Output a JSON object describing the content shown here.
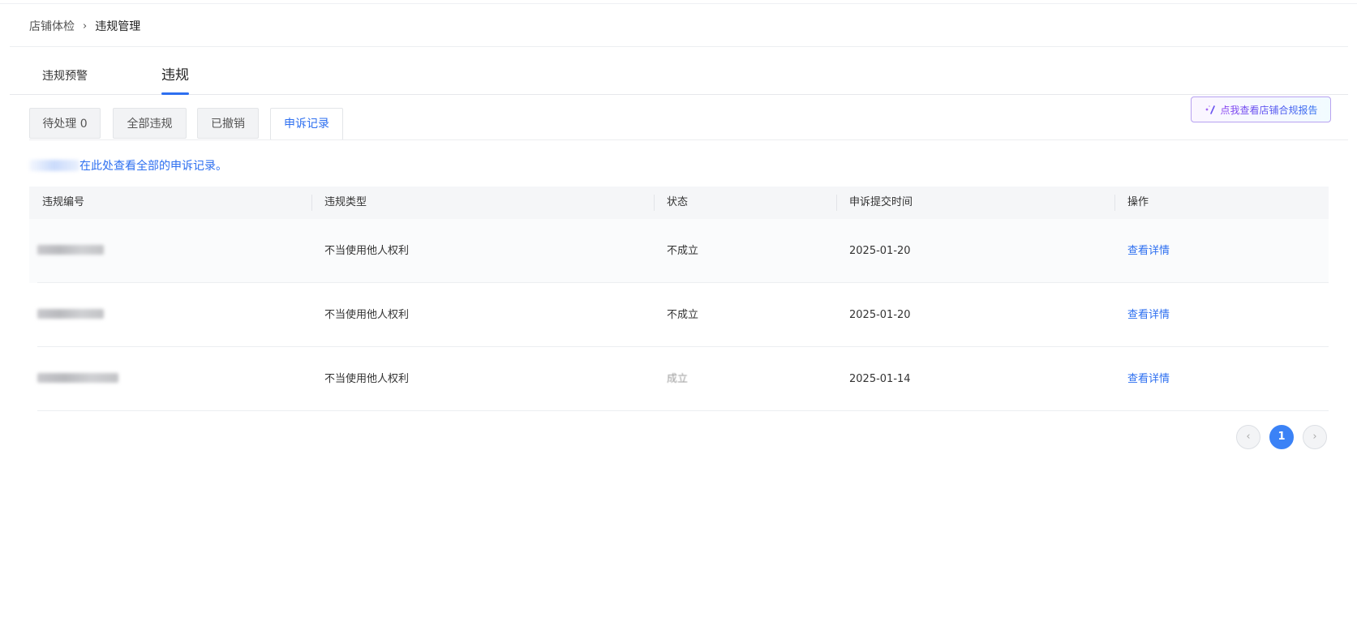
{
  "breadcrumb": {
    "parent": "店铺体检",
    "separator": "›",
    "current": "违规管理"
  },
  "primary_tabs": [
    {
      "label": "违规预警",
      "active": false
    },
    {
      "label": "违规",
      "active": true
    }
  ],
  "secondary_tabs": [
    {
      "label": "待处理 0",
      "active": false
    },
    {
      "label": "全部违规",
      "active": false
    },
    {
      "label": "已撤销",
      "active": false
    },
    {
      "label": "申诉记录",
      "active": true
    }
  ],
  "report_button": {
    "label": "点我查看店铺合规报告",
    "icon": "sparkle-icon"
  },
  "notice": {
    "text": "在此处查看全部的申诉记录。"
  },
  "table": {
    "columns": [
      "违规编号",
      "违规类型",
      "状态",
      "申诉提交时间",
      "操作"
    ],
    "rows": [
      {
        "type": "不当使用他人权利",
        "status": "不成立",
        "time": "2025-01-20",
        "action": "查看详情"
      },
      {
        "type": "不当使用他人权利",
        "status": "不成立",
        "time": "2025-01-20",
        "action": "查看详情"
      },
      {
        "type": "不当使用他人权利",
        "status": "成立",
        "time": "2025-01-14",
        "action": "查看详情"
      }
    ]
  },
  "pagination": {
    "prev": "‹",
    "current": "1",
    "next": "›"
  },
  "colors": {
    "accent": "#2d6ff0",
    "page_current": "#3b82f6"
  }
}
